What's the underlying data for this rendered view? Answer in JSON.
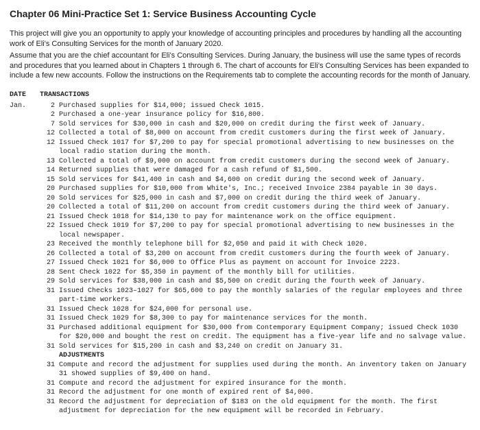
{
  "title": "Chapter 06 Mini-Practice Set 1: Service Business Accounting Cycle",
  "intro": {
    "p1": "This project will give you an opportunity to apply your knowledge of accounting principles and procedures by handling all the accounting work of Eli's Consulting Services for the month of January 2020.",
    "p2": "Assume that you are the chief accountant for Eli's Consulting Services. During January, the business will use the same types of records and procedures that you learned about in Chapters 1 through 6. The chart of accounts for Eli's Consulting Services has been expanded to include a few new accounts. Follow the instructions on the Requirements tab to complete the accounting records for the month of January."
  },
  "ledger": {
    "date_header": "DATE",
    "trans_header": "TRANSACTIONS",
    "month": "Jan.",
    "entries": [
      {
        "day": "2",
        "text": "Purchased supplies for $14,000; issued Check 1015."
      },
      {
        "day": "2",
        "text": "Purchased a one-year insurance policy for $16,800."
      },
      {
        "day": "7",
        "text": "Sold services for $30,000 in cash and $20,000 on credit during the first week of January."
      },
      {
        "day": "12",
        "text": "Collected a total of $8,000 on account from credit customers during the first week of January."
      },
      {
        "day": "12",
        "text": "Issued Check 1017 for $7,200 to pay for special promotional advertising to new businesses on the local radio station during the month."
      },
      {
        "day": "13",
        "text": "Collected a total of $9,000 on account from credit customers during the second week of January."
      },
      {
        "day": "14",
        "text": "Returned supplies that were damaged for a cash refund of $1,500."
      },
      {
        "day": "15",
        "text": "Sold services for $41,400 in cash and $4,600 on credit during the second week of January."
      },
      {
        "day": "20",
        "text": "Purchased supplies for $10,000 from White's, Inc.; received Invoice 2384 payable in 30 days."
      },
      {
        "day": "20",
        "text": "Sold services for $25,000 in cash and $7,000 on credit during the third week of January."
      },
      {
        "day": "20",
        "text": "Collected a total of $11,200 on account from credit customers during the third week of January."
      },
      {
        "day": "21",
        "text": "Issued Check 1018 for $14,130 to pay for maintenance work on the office equipment."
      },
      {
        "day": "22",
        "text": "Issued Check 1019 for $7,200 to pay for special promotional advertising to new businesses in the local newspaper."
      },
      {
        "day": "23",
        "text": "Received the monthly telephone bill for $2,050 and paid it with Check 1020."
      },
      {
        "day": "26",
        "text": "Collected a total of $3,200 on account from credit customers during the fourth week of January."
      },
      {
        "day": "27",
        "text": "Issued Check 1021 for $6,000 to Office Plus as payment on account for Invoice 2223."
      },
      {
        "day": "28",
        "text": "Sent Check 1022 for $5,350 in payment of the monthly bill for utilities."
      },
      {
        "day": "29",
        "text": "Sold services for $38,000 in cash and $5,500 on credit during the fourth week of January."
      },
      {
        "day": "31",
        "text": "Issued Checks 1023–1027 for $65,600 to pay the monthly salaries of the regular employees and three part-time workers."
      },
      {
        "day": "31",
        "text": "Issued Check 1028 for $24,000 for personal use."
      },
      {
        "day": "31",
        "text": "Issued Check 1029 for $8,300 to pay for maintenance services for the month."
      },
      {
        "day": "31",
        "text": "Purchased additional equipment for $30,000 from Contemporary Equipment Company; issued Check 1030 for $20,000 and bought the rest on credit. The equipment has a five-year life and no salvage value."
      },
      {
        "day": "31",
        "text": "Sold services for $15,200 in cash and $3,240 on credit on January 31."
      }
    ],
    "adjustments_header": "ADJUSTMENTS",
    "adjustments": [
      {
        "day": "31",
        "text": "Compute and record the adjustment for supplies used during the month. An inventory taken on January 31 showed supplies of $9,400 on hand."
      },
      {
        "day": "31",
        "text": "Compute and record the adjustment for expired insurance for the month."
      },
      {
        "day": "31",
        "text": "Record the adjustment for one month of expired rent of $4,000."
      },
      {
        "day": "31",
        "text": "Record the adjustment for depreciation of $183 on the old equipment for the month. The first adjustment for depreciation for the new equipment will be recorded in February."
      }
    ]
  }
}
